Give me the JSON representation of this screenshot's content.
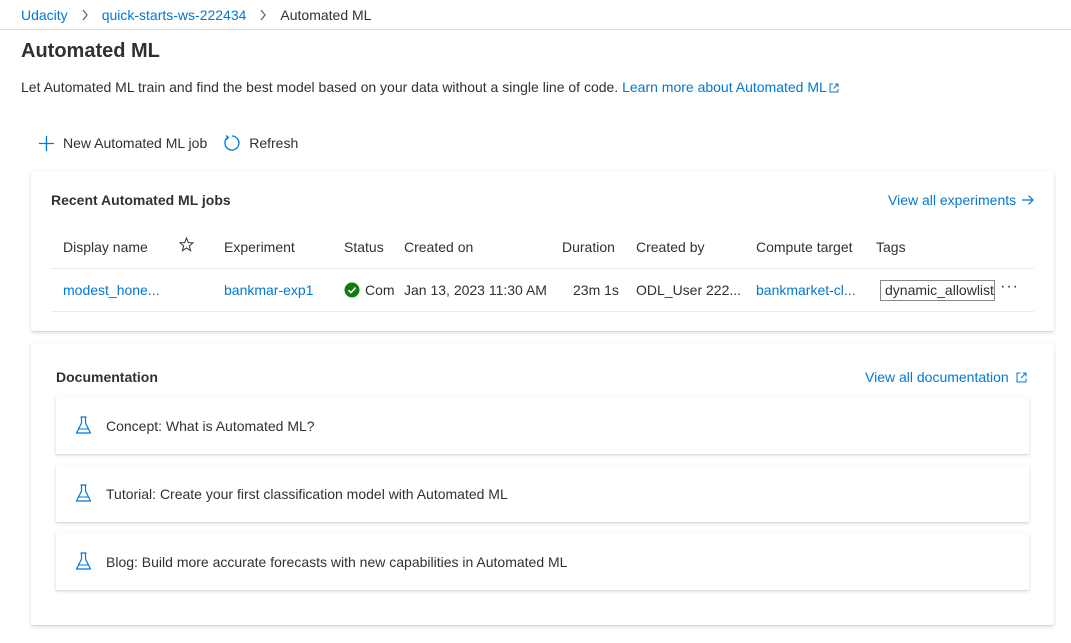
{
  "breadcrumb": {
    "items": [
      "Udacity",
      "quick-starts-ws-222434"
    ],
    "current": "Automated ML"
  },
  "page": {
    "title": "Automated ML",
    "intro_text": "Let Automated ML train and find the best model based on your data without a single line of code.",
    "learn_more_link": "Learn more about Automated ML"
  },
  "toolbar": {
    "new_job_label": "New Automated ML job",
    "refresh_label": "Refresh"
  },
  "jobs": {
    "title": "Recent Automated ML jobs",
    "view_all_label": "View all experiments",
    "columns": [
      "Display name",
      "Experiment",
      "Status",
      "Created on",
      "Duration",
      "Created by",
      "Compute target",
      "Tags"
    ],
    "rows": [
      {
        "display_name": "modest_hone...",
        "experiment": "bankmar-exp1",
        "status": "Com",
        "created_on": "Jan 13, 2023 11:30 AM",
        "duration": "23m 1s",
        "created_by": "ODL_User 222...",
        "compute_target": "bankmarket-cl...",
        "tag": "dynamic_allowlisti",
        "more": "···"
      }
    ]
  },
  "documentation": {
    "title": "Documentation",
    "view_all_label": "View all documentation",
    "items": [
      "Concept: What is Automated ML?",
      "Tutorial: Create your first classification model with Automated ML",
      "Blog: Build more accurate forecasts with new capabilities in Automated ML"
    ]
  },
  "colors": {
    "link": "#0078d4",
    "text": "#323130",
    "success": "#107c10"
  },
  "icons": [
    "chevron-right-icon",
    "external-link-icon",
    "plus-icon",
    "refresh-icon",
    "star-icon",
    "check-circle-icon",
    "arrow-right-icon",
    "flask-icon"
  ]
}
